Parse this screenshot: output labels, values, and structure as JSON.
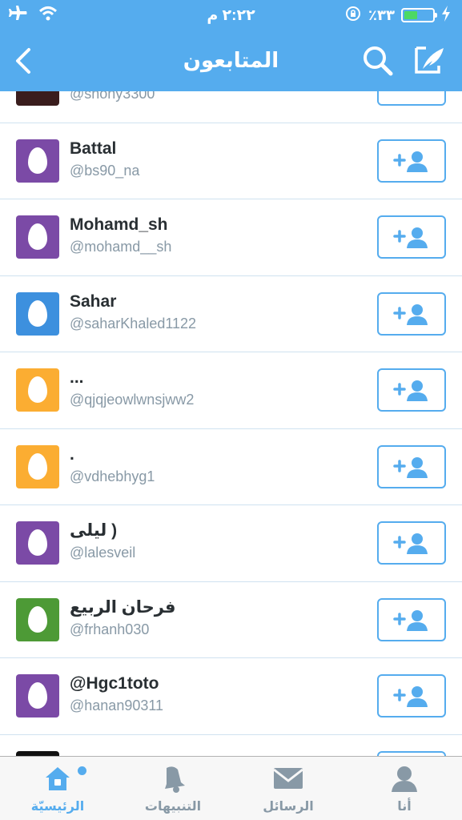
{
  "status_bar": {
    "time": "٢:٢٢ م",
    "battery_percent": "٪٣٣",
    "battery_level": 0.33
  },
  "nav": {
    "title": "المتابعون"
  },
  "partial_top_handle": "@shony3300",
  "followers": [
    {
      "name": "Battal",
      "handle": "@bs90_na",
      "avatar_color": "#7b4aa6"
    },
    {
      "name": "Mohamd_sh",
      "handle": "@mohamd__sh",
      "avatar_color": "#7b4aa6"
    },
    {
      "name": "Sahar",
      "handle": "@saharKhaled1122",
      "avatar_color": "#3d90de"
    },
    {
      "name": "...",
      "handle": "@qjqjeowlwnsjww2",
      "avatar_color": "#fbad32"
    },
    {
      "name": ".",
      "handle": "@vdhebhyg1",
      "avatar_color": "#fbad32"
    },
    {
      "name": "ليلى )",
      "handle": "@lalesveil",
      "avatar_color": "#7b4aa6"
    },
    {
      "name": "فرحان الربيع",
      "handle": "@frhanh030",
      "avatar_color": "#4d9a36"
    },
    {
      "name": "@Hgc1toto",
      "handle": "@hanan90311",
      "avatar_color": "#7b4aa6"
    }
  ],
  "tabs": [
    {
      "label": "الرئيسيّة",
      "icon": "home-icon",
      "active": true
    },
    {
      "label": "التنبيهات",
      "icon": "bell-icon",
      "active": false
    },
    {
      "label": "الرسائل",
      "icon": "envelope-icon",
      "active": false
    },
    {
      "label": "أنا",
      "icon": "person-icon",
      "active": false
    }
  ],
  "colors": {
    "brand_blue": "#55acee",
    "separator": "#cfe2f0",
    "name_text": "#292f33",
    "handle_text": "#8899a6"
  }
}
